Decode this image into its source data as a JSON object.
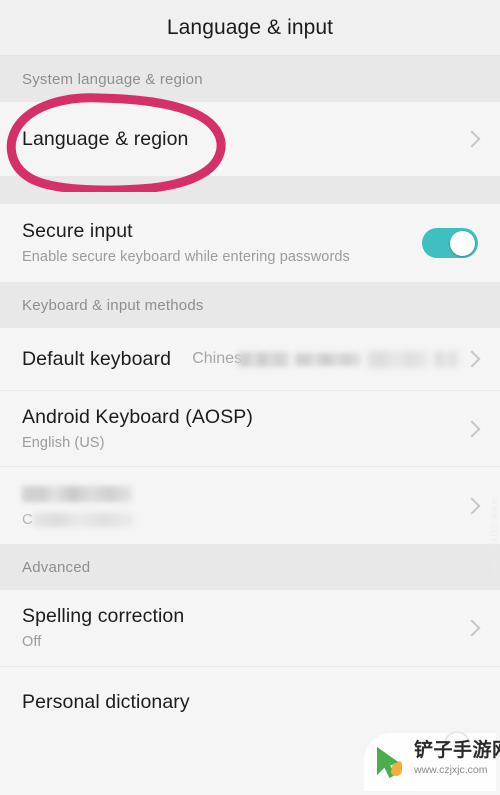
{
  "appbar": {
    "title": "Language & input"
  },
  "sections": [
    {
      "id": "system-language-region",
      "label": "System language & region"
    },
    {
      "id": "keyboard-input-methods",
      "label": "Keyboard & input methods"
    },
    {
      "id": "advanced",
      "label": "Advanced"
    }
  ],
  "rows": {
    "language_region": {
      "title": "Language & region"
    },
    "secure_input": {
      "title": "Secure input",
      "subtitle": "Enable secure keyboard while entering passwords",
      "toggle_state": "on"
    },
    "default_keyboard": {
      "title": "Default keyboard",
      "value_visible": "Chines",
      "value_redacted": true
    },
    "android_keyboard": {
      "title": "Android Keyboard (AOSP)",
      "subtitle": "English (US)"
    },
    "redacted_keyboard": {
      "title_redacted": true,
      "subtitle_visible": "C",
      "subtitle_redacted": true
    },
    "spelling_correction": {
      "title": "Spelling correction",
      "subtitle": "Off"
    },
    "personal_dictionary": {
      "title": "Personal dictionary"
    }
  },
  "annotation": {
    "type": "hand-drawn-circle",
    "color": "#d6306a",
    "targets": "Language & region"
  },
  "watermark": {
    "name": "铲子手游网",
    "url": "www.czjxjc.com",
    "side_text": "www.czjxjc.com"
  },
  "colors": {
    "accent_toggle": "#3fbfc0",
    "annotation_pink": "#d6306a",
    "row_bg": "#f5f5f5",
    "section_bg": "#e8e8e8",
    "title_text": "#1c1c1c",
    "subtitle_text": "#9b9b9b"
  }
}
